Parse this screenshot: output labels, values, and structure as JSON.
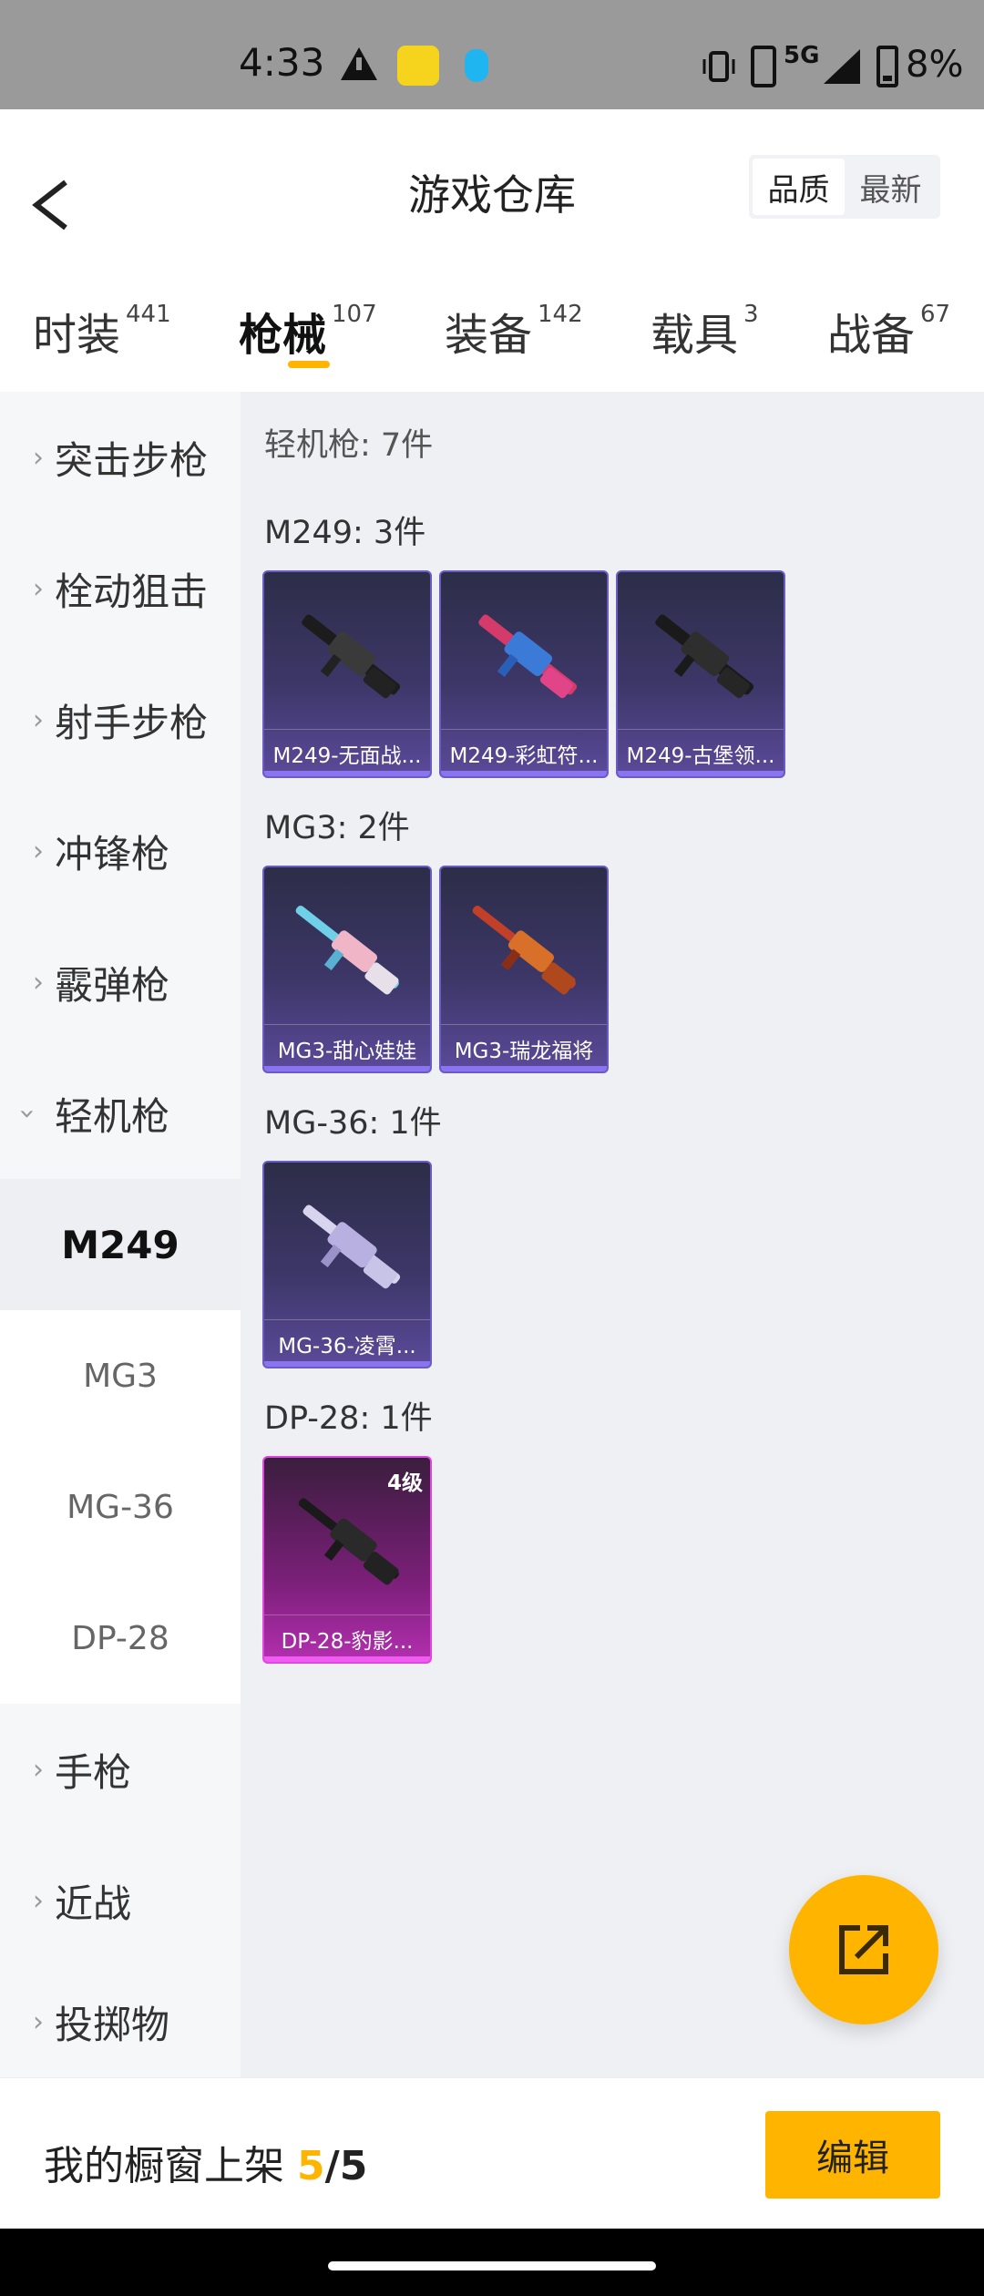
{
  "status_bar": {
    "time": "4:33",
    "network": "5G",
    "battery": "8%"
  },
  "header": {
    "title": "游戏仓库",
    "sort": {
      "quality": "品质",
      "newest": "最新"
    }
  },
  "tabs": [
    {
      "label": "时装",
      "count": "441"
    },
    {
      "label": "枪械",
      "count": "107"
    },
    {
      "label": "装备",
      "count": "142"
    },
    {
      "label": "载具",
      "count": "3"
    },
    {
      "label": "战备",
      "count": "67"
    }
  ],
  "sidebar": {
    "categories": [
      "突击步枪",
      "栓动狙击",
      "射手步枪",
      "冲锋枪",
      "霰弹枪",
      "轻机枪"
    ],
    "subitems": [
      "M249",
      "MG3",
      "MG-36",
      "DP-28"
    ],
    "categories_after": [
      "手枪",
      "近战",
      "投掷物"
    ]
  },
  "main": {
    "section_total": "轻机枪: 7件",
    "groups": [
      {
        "title": "M249: 3件",
        "items": [
          "M249-无面战...",
          "M249-彩虹符...",
          "M249-古堡领..."
        ]
      },
      {
        "title": "MG3: 2件",
        "items": [
          "MG3-甜心娃娃",
          "MG3-瑞龙福将"
        ]
      },
      {
        "title": "MG-36: 1件",
        "items": [
          "MG-36-凌霄..."
        ]
      },
      {
        "title": "DP-28: 1件",
        "items": [
          "DP-28-豹影..."
        ],
        "level": "4级"
      }
    ]
  },
  "bottom": {
    "label": "我的橱窗上架",
    "count": "5",
    "total": "/5",
    "edit": "编辑"
  },
  "colors": {
    "accent": "#ffb400",
    "card_purple": "#3d3768",
    "card_pink": "#b42fb0"
  }
}
